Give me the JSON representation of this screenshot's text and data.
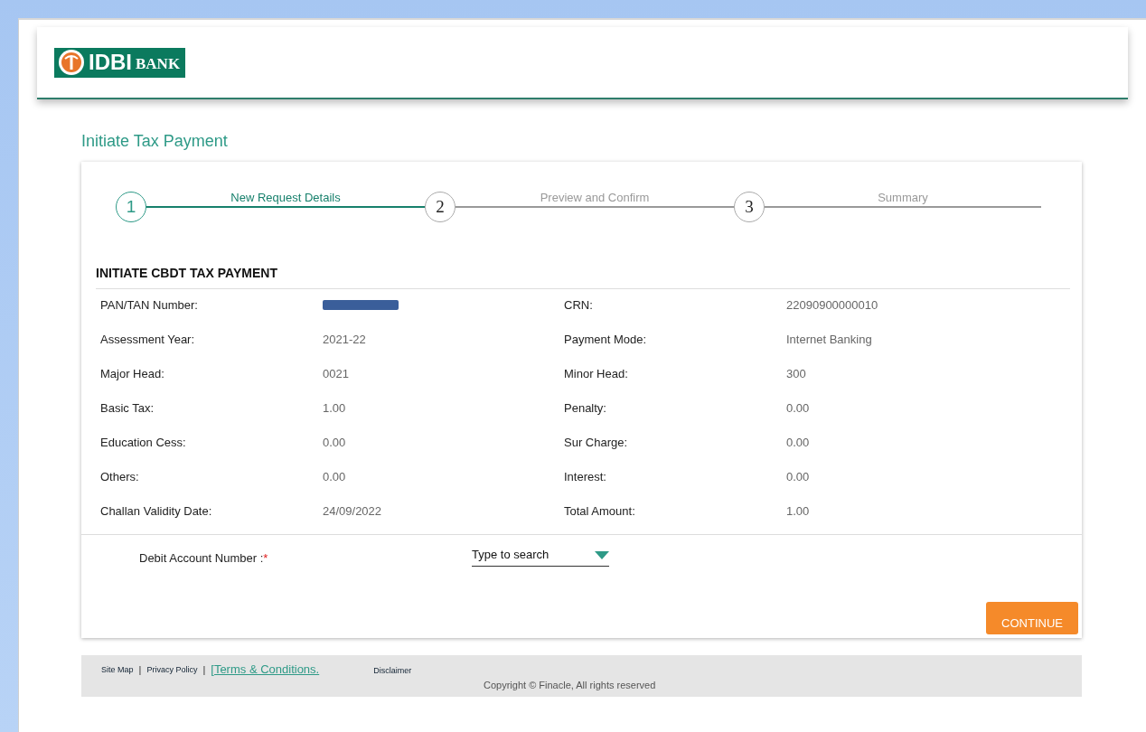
{
  "logo": {
    "name": "IDBI",
    "suffix": "BANK"
  },
  "page_title": "Initiate Tax Payment",
  "steps": [
    {
      "number": "1",
      "label": "New Request Details",
      "selected": true
    },
    {
      "number": "2",
      "label": "Preview and Confirm",
      "selected": false
    },
    {
      "number": "3",
      "label": "Summary",
      "selected": false
    }
  ],
  "section_title": "INITIATE CBDT TAX PAYMENT",
  "details": [
    {
      "label": "PAN/TAN Number:",
      "redacted": true
    },
    {
      "label": "CRN:",
      "value": "22090900000010",
      "redacted": false
    },
    {
      "label": "Assessment Year:",
      "value": "2021-22",
      "redacted": false
    },
    {
      "label": "Payment Mode:",
      "value": "Internet Banking",
      "redacted": false
    },
    {
      "label": "Major Head:",
      "value": "0021",
      "redacted": false
    },
    {
      "label": "Minor Head:",
      "value": "300",
      "redacted": false
    },
    {
      "label": "Basic Tax:",
      "value": "1.00",
      "redacted": false
    },
    {
      "label": "Penalty:",
      "value": "0.00",
      "redacted": false
    },
    {
      "label": "Education Cess:",
      "value": "0.00",
      "redacted": false
    },
    {
      "label": "Sur Charge:",
      "value": "0.00",
      "redacted": false
    },
    {
      "label": "Others:",
      "value": "0.00",
      "redacted": false
    },
    {
      "label": "Interest:",
      "value": "0.00",
      "redacted": false
    },
    {
      "label": "Challan Validity Date:",
      "value": "24/09/2022",
      "redacted": false
    },
    {
      "label": "Total Amount:",
      "value": "1.00",
      "redacted": false
    }
  ],
  "debit_account": {
    "label": "Debit Account Number :",
    "required_mark": "*",
    "placeholder": "Type to search"
  },
  "continue_button": "CONTINUE",
  "footer": {
    "links": [
      {
        "label": "Site Map",
        "kind": "small"
      },
      {
        "label": "|",
        "kind": "sep"
      },
      {
        "label": "Privacy Policy",
        "kind": "small"
      },
      {
        "label": "|",
        "kind": "sep"
      },
      {
        "label": "[Terms & Conditions.",
        "kind": "big"
      },
      {
        "label": "Disclaimer",
        "kind": "small"
      }
    ],
    "copyright": "Copyright © Finacle, All rights reserved"
  }
}
